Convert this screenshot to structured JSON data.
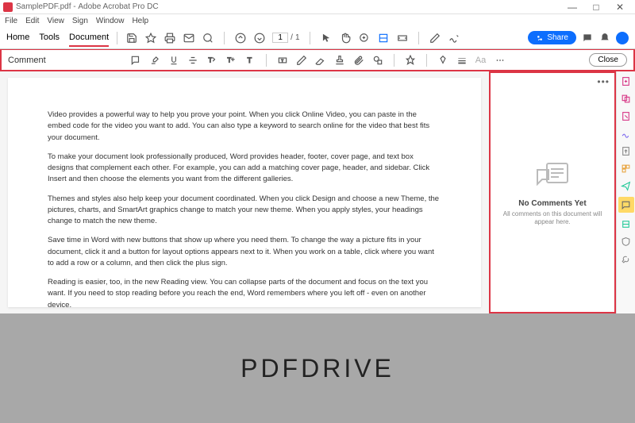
{
  "titlebar": {
    "filename": "SamplePDF.pdf",
    "appname": "Adobe Acrobat Pro DC"
  },
  "menubar": [
    "File",
    "Edit",
    "View",
    "Sign",
    "Window",
    "Help"
  ],
  "tabs": {
    "home": "Home",
    "tools": "Tools",
    "document": "Document"
  },
  "page_nav": {
    "current": "1",
    "total": "1",
    "sep": "/"
  },
  "share_label": "Share",
  "comment_bar": {
    "label": "Comment",
    "close": "Close",
    "font_size": "Aa"
  },
  "document": {
    "p1": "Video provides a powerful way to help you prove your point. When you click Online Video, you can paste in the embed code for the video you want to add. You can also type a keyword to search online for the video that best fits your document.",
    "p2": "To make your document look professionally produced, Word provides header, footer, cover page, and text box designs that complement each other. For example, you can add a matching cover page, header, and sidebar. Click Insert and then choose the elements you want from the different galleries.",
    "p3": "Themes and styles also help keep your document coordinated. When you click Design and choose a new Theme, the pictures, charts, and SmartArt graphics change to match your new theme. When you apply styles, your headings change to match the new theme.",
    "p4": "Save time in Word with new buttons that show up where you need them. To change the way a picture fits in your document, click it and a button for layout options appears next to it. When you work on a table, click where you want to add a row or a column, and then click the plus sign.",
    "p5": "Reading is easier, too, in the new Reading view. You can collapse parts of the document and focus on the text you want. If you need to stop reading before you reach the end, Word remembers where you left off - even on another device."
  },
  "comments_panel": {
    "title": "No Comments Yet",
    "subtitle": "All comments on this document will appear here."
  },
  "footer": "PDFDRIVE"
}
